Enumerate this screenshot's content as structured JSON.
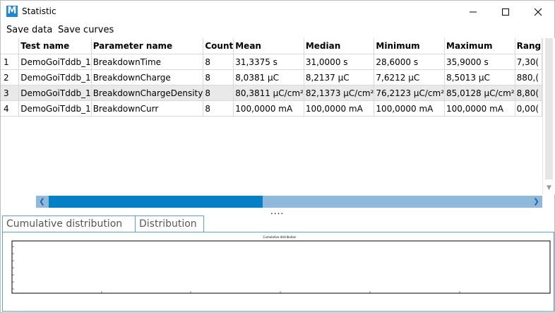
{
  "window": {
    "title": "Statistic",
    "icon": "M"
  },
  "menu": {
    "items": [
      "Save data",
      "Save curves"
    ]
  },
  "grid": {
    "columns": [
      "",
      "Test name",
      "Parameter name",
      "Count",
      "Mean",
      "Median",
      "Minimum",
      "Maximum",
      "Rang"
    ],
    "rows": [
      [
        "1",
        "DemoGoiTddb_1",
        "BreakdownTime",
        "8",
        "31,3375 s",
        "31,0000 s",
        "28,6000 s",
        "35,9000 s",
        "7,30("
      ],
      [
        "2",
        "DemoGoiTddb_1",
        "BreakdownCharge",
        "8",
        "8,0381 µC",
        "8,2137 µC",
        "7,6212 µC",
        "8,5013 µC",
        "880,("
      ],
      [
        "3",
        "DemoGoiTddb_1",
        "BreakdownChargeDensity",
        "8",
        "80,3811 µC/cm²",
        "82,1373 µC/cm²",
        "76,2123 µC/cm²",
        "85,0128 µC/cm²",
        "8,80("
      ],
      [
        "4",
        "DemoGoiTddb_1",
        "BreakdownCurr",
        "8",
        "100,0000 mA",
        "100,0000 mA",
        "100,0000 mA",
        "100,0000 mA",
        "0,00("
      ]
    ]
  },
  "splitter": "....",
  "tabs": [
    "Cumulative distribution",
    "Distribution"
  ],
  "plot": {
    "title": "Cumulative distribution"
  }
}
